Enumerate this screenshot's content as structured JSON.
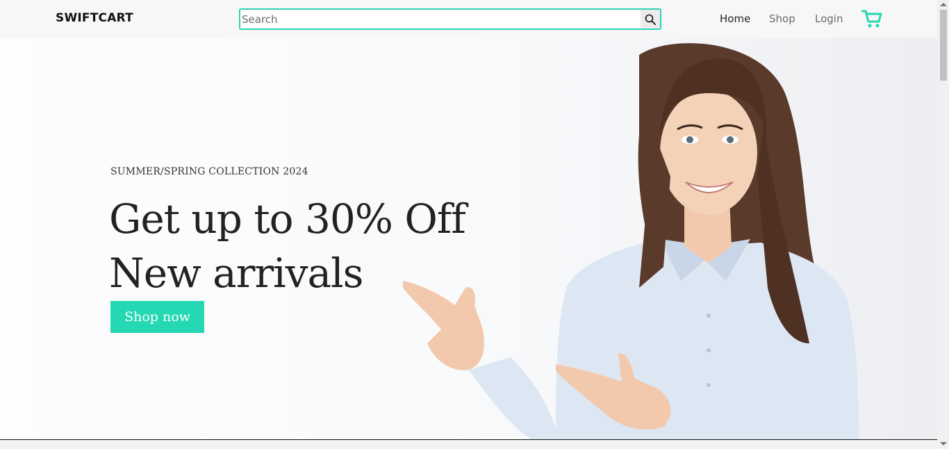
{
  "header": {
    "brand": "SWIFTCART",
    "search_placeholder": "Search",
    "nav": [
      {
        "label": "Home"
      },
      {
        "label": "Shop"
      },
      {
        "label": "Login"
      }
    ],
    "accent_color": "#23d8b2"
  },
  "hero": {
    "eyebrow": "SUMMER/SPRING COLLECTION 2024",
    "headline_line1": "Get up to 30% Off",
    "headline_line2": "New arrivals",
    "cta_label": "Shop now"
  },
  "icons": {
    "search": "search-icon",
    "cart": "cart-icon"
  }
}
